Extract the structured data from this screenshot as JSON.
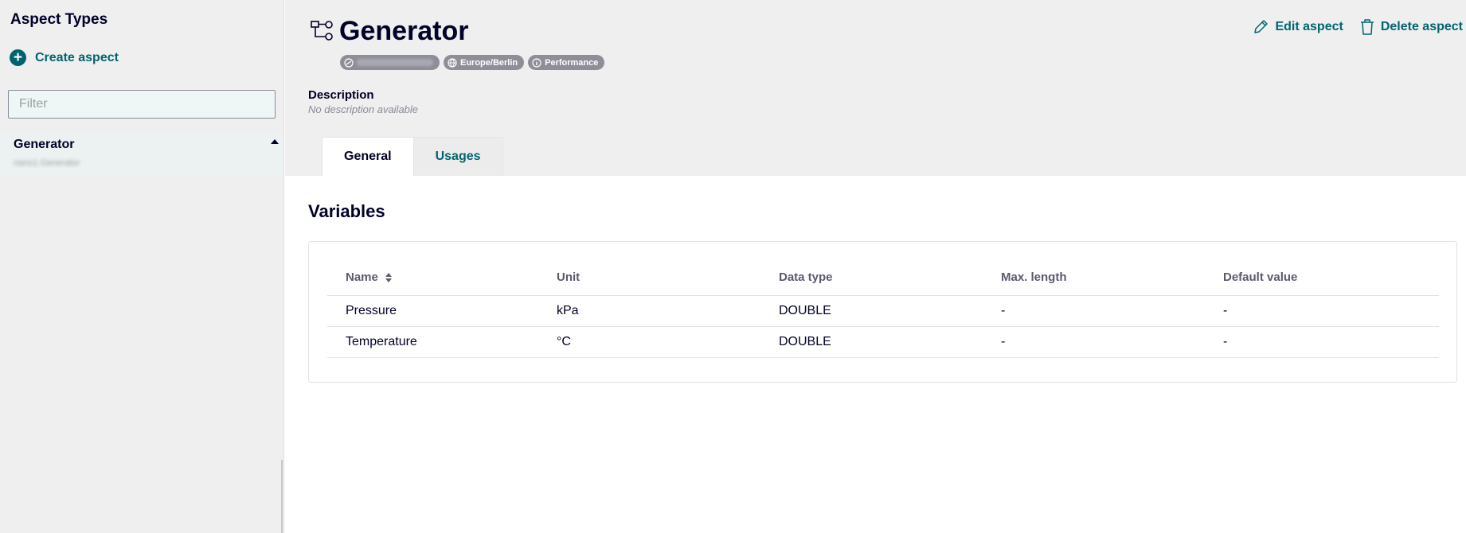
{
  "sidebar": {
    "title": "Aspect Types",
    "create_label": "Create aspect",
    "filter_placeholder": "Filter",
    "items": [
      {
        "label": "Generator",
        "sublabel": "nano1.Generator"
      }
    ]
  },
  "header": {
    "title": "Generator",
    "badges": {
      "tenant": "",
      "timezone": "Europe/Berlin",
      "category": "Performance"
    },
    "edit_label": "Edit aspect",
    "delete_label": "Delete aspect",
    "description_title": "Description",
    "description_text": "No description available"
  },
  "tabs": [
    {
      "label": "General",
      "active": true
    },
    {
      "label": "Usages",
      "active": false
    }
  ],
  "main": {
    "section_title": "Variables",
    "table": {
      "headers": [
        "Name",
        "Unit",
        "Data type",
        "Max. length",
        "Default value"
      ],
      "rows": [
        [
          "Pressure",
          "kPa",
          "DOUBLE",
          "-",
          "-"
        ],
        [
          "Temperature",
          "°C",
          "DOUBLE",
          "-",
          "-"
        ]
      ]
    }
  },
  "colors": {
    "accent": "#00646e",
    "text": "#000028",
    "badge": "#8e8e99",
    "panel": "#efefef"
  }
}
